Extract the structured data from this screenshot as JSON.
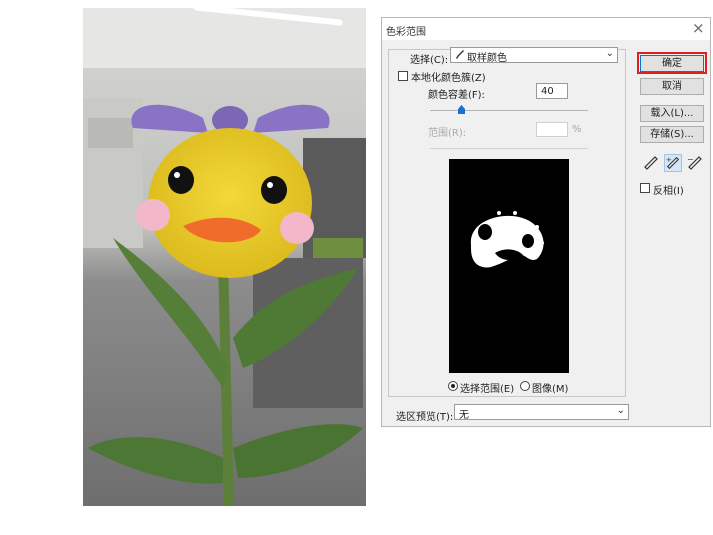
{
  "dialog": {
    "title": "色彩范围",
    "close_symbol": "×",
    "select": {
      "label": "选择(C):",
      "value": "取样颜色",
      "icon": "eyedropper-icon"
    },
    "localized_clusters": {
      "label": "本地化颜色簇(Z)",
      "checked": false
    },
    "fuzziness": {
      "label": "颜色容差(F):",
      "value": "40"
    },
    "range": {
      "label": "范围(R):",
      "value": "",
      "unit": "%"
    },
    "view_options": [
      {
        "label": "选择范围(E)",
        "selected": true
      },
      {
        "label": "图像(M)",
        "selected": false
      }
    ],
    "selection_preview": {
      "label": "选区预览(T):",
      "value": "无"
    },
    "buttons": {
      "ok": "确定",
      "cancel": "取消",
      "load": "载入(L)...",
      "save": "存储(S)..."
    },
    "invert": {
      "label": "反相(I)",
      "checked": false
    }
  },
  "colors": {
    "highlight": "#e02020",
    "preview_bg": "#000000",
    "dialog_bg": "#f0f0f0"
  }
}
